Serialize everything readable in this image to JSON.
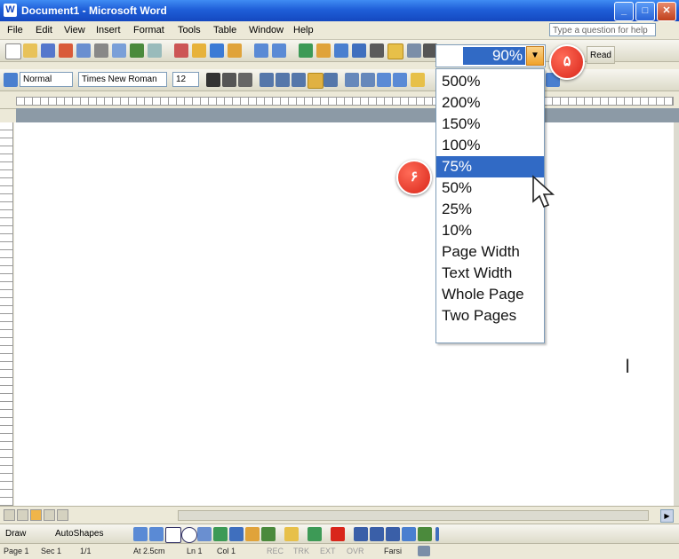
{
  "window": {
    "title": "Document1 - Microsoft Word",
    "app_icon": "W",
    "buttons": {
      "minimize": "_",
      "maximize": "□",
      "close": "✕"
    }
  },
  "menubar": {
    "items": [
      "File",
      "Edit",
      "View",
      "Insert",
      "Format",
      "Tools",
      "Table",
      "Window",
      "Help"
    ],
    "help_placeholder": "Type a question for help"
  },
  "formatting": {
    "style": "Normal",
    "font": "Times New Roman",
    "size": "12"
  },
  "zoom": {
    "current": "90%",
    "options": [
      "500%",
      "200%",
      "150%",
      "100%",
      "75%",
      "50%",
      "25%",
      "10%",
      "Page Width",
      "Text Width",
      "Whole Page",
      "Two Pages"
    ],
    "selected": "75%"
  },
  "toolbar": {
    "read_label": "Read"
  },
  "badges": {
    "step_a": "۵",
    "step_b": "۶"
  },
  "drawing": {
    "draw_label": "Draw",
    "autoshapes_label": "AutoShapes"
  },
  "statusbar": {
    "items": [
      "Page 1",
      "Sec 1",
      "1/1",
      "At 2.5cm",
      "Ln 1",
      "Col 1",
      "REC",
      "TRK",
      "EXT",
      "OVR",
      "Farsi"
    ]
  },
  "colors": {
    "titlebar": "#1f5fd8",
    "selection": "#316ac5",
    "badge": "#d9261a"
  }
}
